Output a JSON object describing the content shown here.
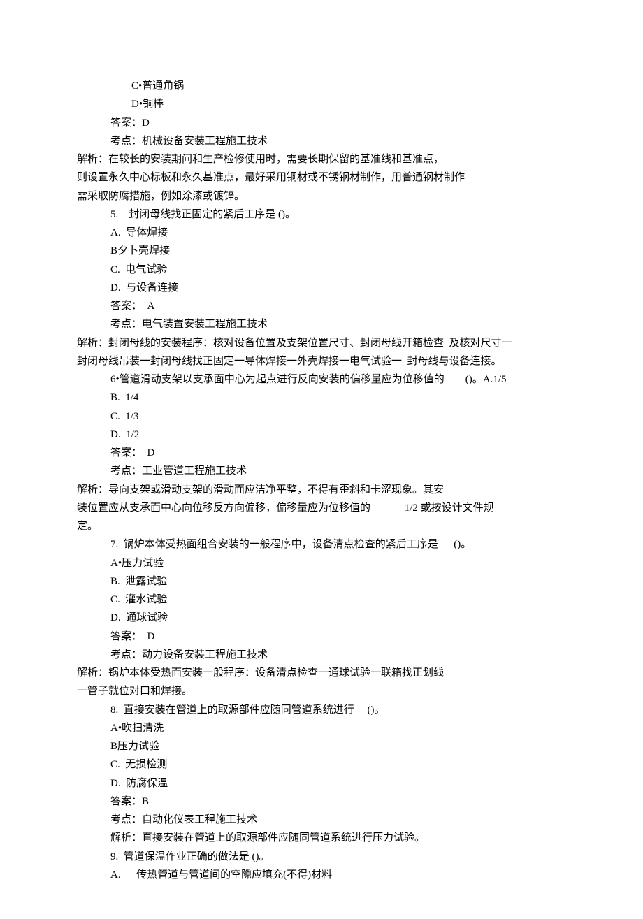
{
  "lines": [
    {
      "cls": "indent-2",
      "text": "C•普通角锅"
    },
    {
      "cls": "indent-2",
      "text": "D•铜棒"
    },
    {
      "cls": "indent-1",
      "text": "答案：D"
    },
    {
      "cls": "indent-1",
      "text": "考点：机械设备安装工程施工技术"
    },
    {
      "cls": "no-indent",
      "text": "解析：在较长的安装期间和生产检修使用时，需要长期保留的基准线和基准点，"
    },
    {
      "cls": "no-indent",
      "text": "则设置永久中心标板和永久基准点，最好采用铜材或不锈钢材制作，用普通钢材制作"
    },
    {
      "cls": "no-indent",
      "text": "需采取防腐措施，例如涂漆或镀锌。"
    },
    {
      "cls": "indent-q",
      "text": "5.    封闭母线找正固定的紧后工序是 ()。"
    },
    {
      "cls": "indent-opt",
      "text": "A.  导体焊接"
    },
    {
      "cls": "indent-opt",
      "text": "B夕卜壳焊接"
    },
    {
      "cls": "indent-opt",
      "text": "C.  电气试验"
    },
    {
      "cls": "indent-opt",
      "text": "D.  与设备连接"
    },
    {
      "cls": "indent-1",
      "text": "答案：  A"
    },
    {
      "cls": "indent-1",
      "text": "考点：电气装置安装工程施工技术"
    },
    {
      "cls": "no-indent",
      "text": "解析：封闭母线的安装程序：核对设备位置及支架位置尺寸、封闭母线开箱检查  及核对尺寸一"
    },
    {
      "cls": "no-indent",
      "text": "封闭母线吊装一封闭母线找正固定一导体焊接一外壳焊接一电气试验一  封母线与设备连接。"
    },
    {
      "cls": "indent-q",
      "text": "6•管道滑动支架以支承面中心为起点进行反向安装的偏移量应为位移值的        ()。A.1/5"
    },
    {
      "cls": "indent-opt",
      "text": "B.  1/4"
    },
    {
      "cls": "indent-opt",
      "text": "C.  1/3"
    },
    {
      "cls": "indent-opt",
      "text": "D.  1/2"
    },
    {
      "cls": "indent-1",
      "text": "答案：  D"
    },
    {
      "cls": "indent-1",
      "text": "考点：工业管道工程施工技术"
    },
    {
      "cls": "no-indent",
      "text": "解析：导向支架或滑动支架的滑动面应洁净平整，不得有歪斜和卡涩现象。其安"
    },
    {
      "cls": "no-indent",
      "text": "装位置应从支承面中心向位移反方向偏移，偏移量应为位移值的             1/2 或按设计文件规"
    },
    {
      "cls": "no-indent",
      "text": "定。"
    },
    {
      "cls": "indent-q",
      "text": "7.  锅炉本体受热面组合安装的一般程序中，设备清点检查的紧后工序是      ()。"
    },
    {
      "cls": "indent-opt",
      "text": "A•压力试验"
    },
    {
      "cls": "indent-opt",
      "text": "B.  泄露试验"
    },
    {
      "cls": "indent-opt",
      "text": "C.  灌水试验"
    },
    {
      "cls": "indent-opt",
      "text": "D.  通球试验"
    },
    {
      "cls": "indent-1",
      "text": "答案：  D"
    },
    {
      "cls": "indent-1",
      "text": "考点：动力设备安装工程施工技术"
    },
    {
      "cls": "no-indent",
      "text": "解析：锅炉本体受热面安装一般程序：设备清点检查一通球试验一联箱找正划线"
    },
    {
      "cls": "no-indent",
      "text": "一管子就位对口和焊接。"
    },
    {
      "cls": "indent-q",
      "text": "8.  直接安装在管道上的取源部件应随同管道系统进行     ()。"
    },
    {
      "cls": "indent-opt",
      "text": "A•吹扫清洗"
    },
    {
      "cls": "indent-opt",
      "text": "B压力试验"
    },
    {
      "cls": "indent-opt",
      "text": "C.  无损检测"
    },
    {
      "cls": "indent-opt",
      "text": "D.  防腐保温"
    },
    {
      "cls": "indent-1",
      "text": "答案：B"
    },
    {
      "cls": "indent-1",
      "text": "考点：自动化仪表工程施工技术"
    },
    {
      "cls": "indent-1",
      "text": "解析：直接安装在管道上的取源部件应随同管道系统进行压力试验。"
    },
    {
      "cls": "indent-q",
      "text": "9.  管道保温作业正确的做法是 ()。"
    },
    {
      "cls": "indent-opt",
      "text": "A.      传热管道与管道间的空隙应填充(不得)材料"
    }
  ]
}
